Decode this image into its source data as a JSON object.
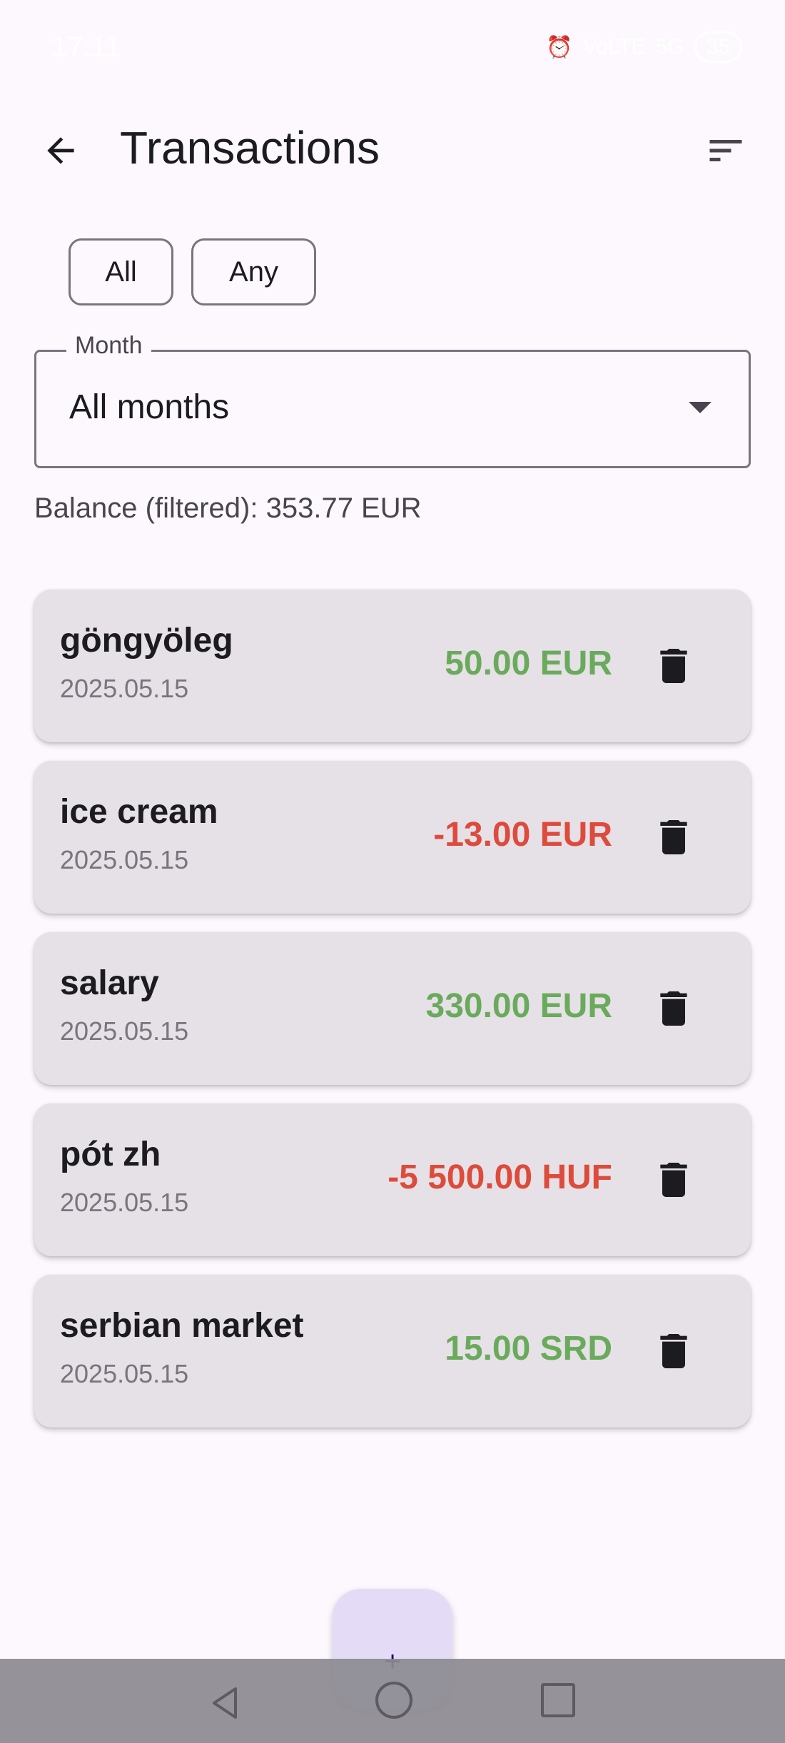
{
  "status_bar": {
    "time": "17:11",
    "icons": [
      "alarm-icon",
      "volte-icon",
      "signal-5g-icon"
    ],
    "network": "5G",
    "volte": "VoLTE",
    "battery": "35"
  },
  "app_bar": {
    "title": "Transactions",
    "back_icon": "arrow-back-icon",
    "sort_icon": "sort-icon"
  },
  "filters": {
    "chips": [
      {
        "label": "All"
      },
      {
        "label": "Any"
      }
    ]
  },
  "month_select": {
    "label": "Month",
    "value": "All months"
  },
  "balance": {
    "text": "Balance (filtered): 353.77 EUR"
  },
  "transactions": [
    {
      "name": "göngyöleg",
      "date": "2025.05.15",
      "amount": "50.00 EUR",
      "sign": "positive"
    },
    {
      "name": "ice cream",
      "date": "2025.05.15",
      "amount": "-13.00 EUR",
      "sign": "negative"
    },
    {
      "name": "salary",
      "date": "2025.05.15",
      "amount": "330.00 EUR",
      "sign": "positive"
    },
    {
      "name": "pót zh",
      "date": "2025.05.15",
      "amount": "-5 500.00 HUF",
      "sign": "negative"
    },
    {
      "name": "serbian market",
      "date": "2025.05.15",
      "amount": "15.00 SRD",
      "sign": "positive"
    }
  ],
  "fab": {
    "label": "+"
  },
  "colors": {
    "positive": "#6aaa5c",
    "negative": "#dd4b3c",
    "card": "#e6e1e6",
    "fab": "#e4dcf6",
    "background": "#fcf8fd"
  }
}
